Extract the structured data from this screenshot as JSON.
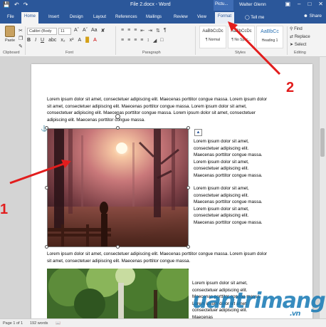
{
  "titlebar": {
    "doc_title": "File 2.docx - Word",
    "picture_tools": "Pictu...",
    "user": "Walter Glenn",
    "icons": [
      "save-icon",
      "undo-icon",
      "redo-icon"
    ]
  },
  "tabs": [
    "File",
    "Home",
    "Insert",
    "Design",
    "Layout",
    "References",
    "Mailings",
    "Review",
    "View",
    "Format"
  ],
  "tell_me": "Tell me",
  "share": "Share",
  "ribbon": {
    "paste": "Paste",
    "font_name": "Calibri (Body",
    "font_size": "11",
    "group_labels": {
      "clipboard": "Clipboard",
      "font": "Font",
      "paragraph": "Paragraph",
      "styles": "Styles",
      "editing": "Editing"
    },
    "styles": [
      {
        "sample": "AaBbCcDc",
        "name": "¶ Normal"
      },
      {
        "sample": "AaBbCcDc",
        "name": "¶ No Spac..."
      },
      {
        "sample": "AaBbCc",
        "name": "Heading 1"
      }
    ],
    "editing": {
      "find": "Find",
      "replace": "Replace",
      "select": "Select"
    }
  },
  "document": {
    "para1": "Lorem ipsum dolor sit amet, consectetuer adipiscing elit. Maecenas porttitor congue massa. Lorem ipsum dolor sit amet, consectetuer adipiscing elit. Maecenas porttitor congue massa. Lorem ipsum dolor sit amet, consectetuer adipiscing elit. Maecenas porttitor congue massa. Lorem ipsum dolor sit amet, consectetuer adipiscing elit. Maecenas porttitor congue massa.",
    "side_block1": "Lorem ipsum dolor sit amet, consectetuer adipiscing elit. Maecenas porttitor congue massa. Lorem ipsum dolor sit amet, consectetuer adipiscing elit. Maecenas porttitor congue massa.",
    "side_block2": "Lorem ipsum dolor sit amet, consectetuer adipiscing elit. Maecenas porttitor congue massa. Lorem ipsum dolor sit amet, consectetuer adipiscing elit. Maecenas porttitor congue massa.",
    "para2": "Lorem ipsum dolor sit amet, consectetuer adipiscing elit. Maecenas porttitor congue massa. Lorem ipsum dolor sit amet, consectetuer adipiscing elit. Maecenas porttitor congue massa.",
    "side_block3": "Lorem ipsum dolor sit amet, consectetuer adipiscing elit. Maecenas porttitor congue massa. Lorem ipsum dolor sit amet, consectetuer adipiscing elit. Maecenas"
  },
  "status": {
    "page": "Page 1 of 1",
    "words": "192 words"
  },
  "annotations": {
    "label1": "1",
    "label2": "2"
  },
  "watermark": {
    "text": "uantrimang",
    "suffix": ".vn"
  },
  "colors": {
    "word_blue": "#2b579a",
    "annotation_red": "#e21d1d"
  }
}
